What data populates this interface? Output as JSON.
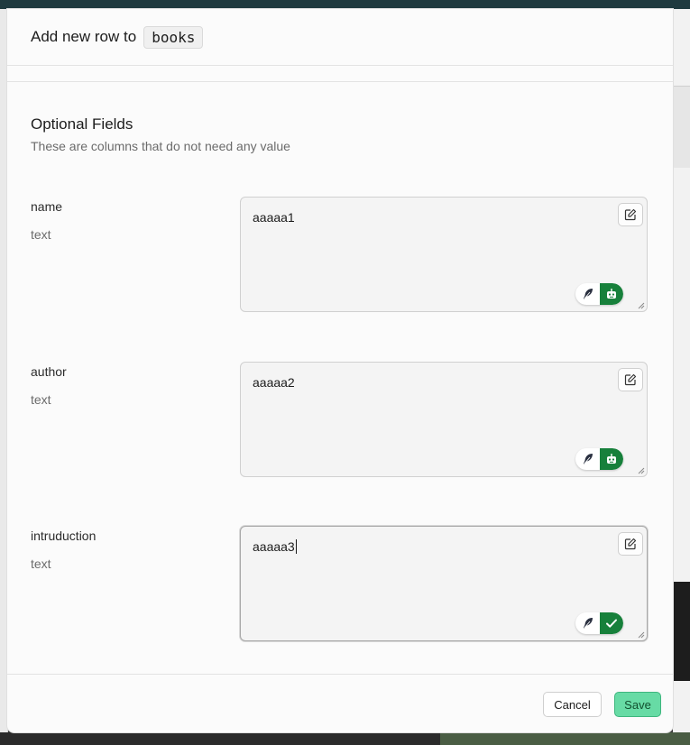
{
  "dialog": {
    "title_prefix": "Add new row to",
    "table_name": "books"
  },
  "section": {
    "title": "Optional Fields",
    "description": "These are columns that do not need any value"
  },
  "fields": [
    {
      "name": "name",
      "type": "text",
      "value": "aaaaa1",
      "ai_status": "robot"
    },
    {
      "name": "author",
      "type": "text",
      "value": "aaaaa2",
      "ai_status": "robot"
    },
    {
      "name": "intruduction",
      "type": "text",
      "value": "aaaaa3",
      "ai_status": "check"
    }
  ],
  "footer": {
    "cancel_label": "Cancel",
    "save_label": "Save"
  },
  "colors": {
    "accent_green": "#17803b",
    "save_button": "#67dba5"
  },
  "icons": [
    "edit-icon",
    "feather-icon",
    "robot-icon",
    "check-icon",
    "resize-handle-icon"
  ]
}
